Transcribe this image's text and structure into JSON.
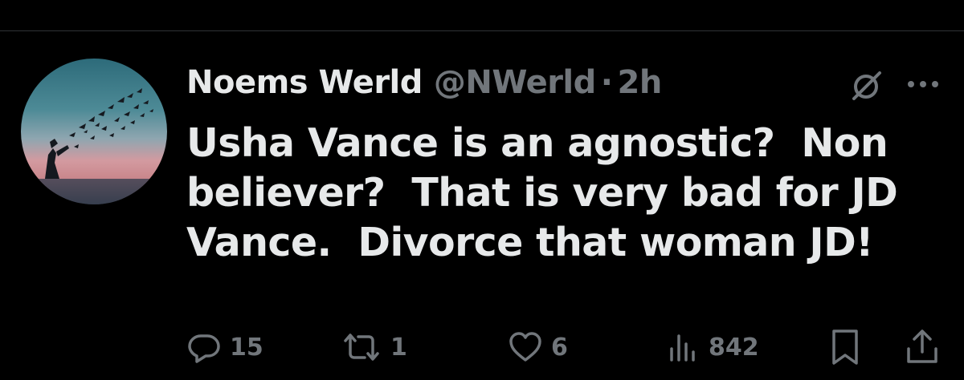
{
  "tweet": {
    "author": {
      "display_name": "Noems Werld",
      "handle": "@NWerld",
      "avatar_icon": "avatar-birds-silhouette"
    },
    "separator": "·",
    "time": "2h",
    "text": "Usha Vance is an agnostic?  Non\nbeliever?  That is very bad for JD\nVance.  Divorce that woman JD!",
    "header_icons": [
      "grok-icon",
      "more-icon"
    ]
  },
  "actions": {
    "reply": {
      "icon": "reply-icon",
      "count": "15"
    },
    "retweet": {
      "icon": "retweet-icon",
      "count": "1"
    },
    "like": {
      "icon": "heart-icon",
      "count": "6"
    },
    "views": {
      "icon": "views-icon",
      "count": "842"
    },
    "bookmark": {
      "icon": "bookmark-icon"
    },
    "share": {
      "icon": "share-icon"
    }
  },
  "colors": {
    "background": "#000000",
    "text_primary": "#e7e9ea",
    "text_secondary": "#71767b",
    "divider": "#2f3336"
  }
}
